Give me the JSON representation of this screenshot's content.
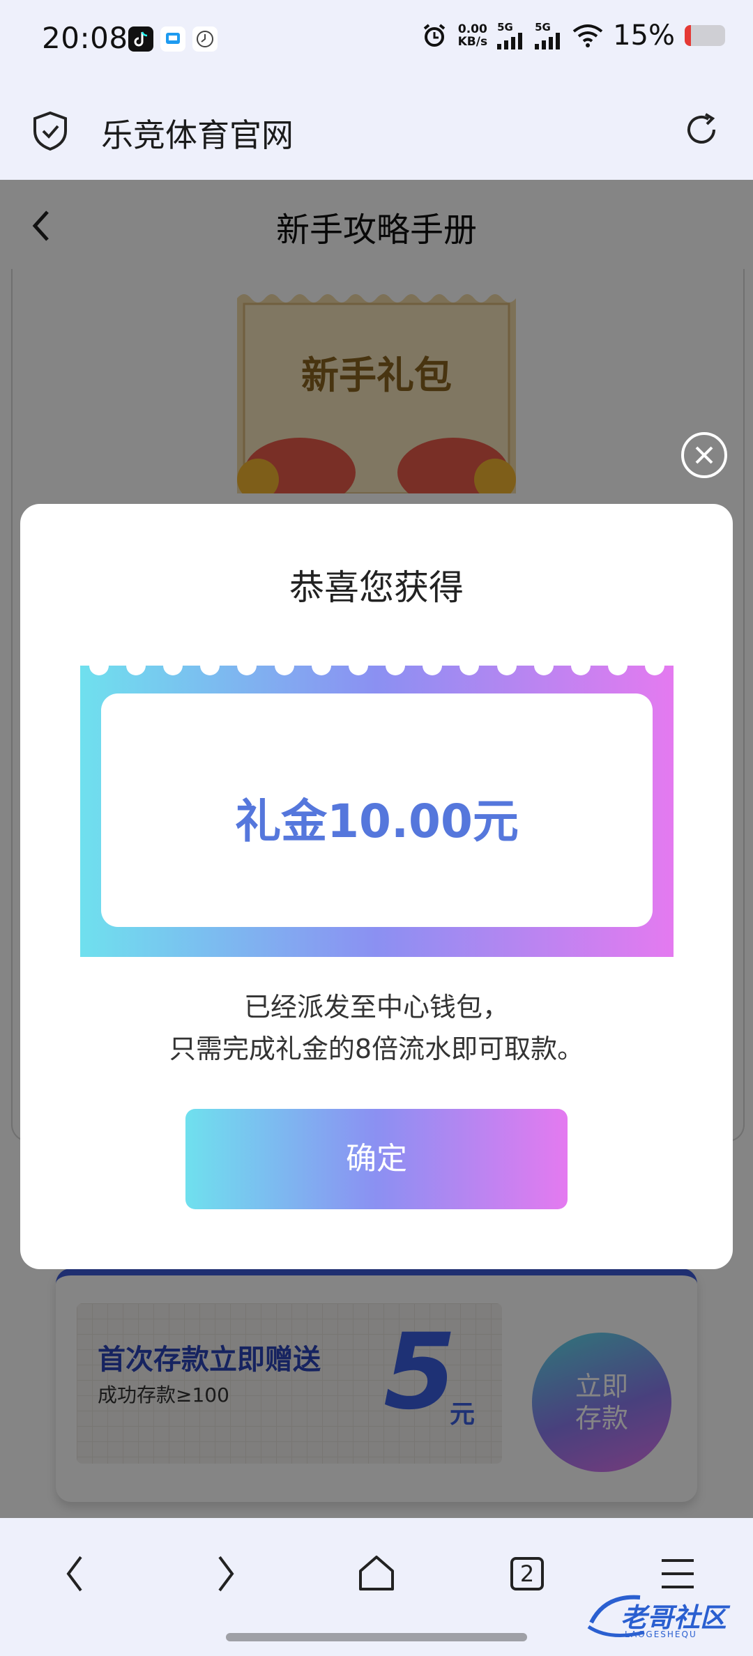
{
  "status_bar": {
    "time": "20:08",
    "net_speed_value": "0.00",
    "net_speed_unit": "KB/s",
    "sim1_label": "5G",
    "sim2_label": "5G",
    "battery_percent": "15%",
    "battery_level": 0.15,
    "icons": [
      "tiktok-icon",
      "app-icon",
      "clock-app-icon",
      "alarm-icon",
      "signal-icon",
      "signal-icon",
      "wifi-icon",
      "battery-icon"
    ]
  },
  "browser": {
    "site_title": "乐竞体育官网",
    "icons": [
      "shield-check-icon",
      "refresh-icon"
    ]
  },
  "page": {
    "header_title": "新手攻略手册",
    "gift_ticket_text": "新手礼包",
    "promo": {
      "title": "首次存款立即赠送",
      "subtitle": "成功存款≥100",
      "amount": "5",
      "unit": "元",
      "button_label_line1": "立即",
      "button_label_line2": "存款"
    }
  },
  "modal": {
    "title": "恭喜您获得",
    "reward_amount": "礼金10.00元",
    "description_line1": "已经派发至中心钱包，",
    "description_line2": "只需完成礼金的8倍流水即可取款。",
    "confirm_label": "确定"
  },
  "bottom_nav": {
    "tab_count": "2",
    "items": [
      "back-icon",
      "forward-icon",
      "home-icon",
      "tabs-icon",
      "menu-icon"
    ]
  },
  "watermark": {
    "text": "老哥社区",
    "sub": "LAOGESHEQU"
  },
  "colors": {
    "accent_blue": "#5577dc",
    "gradient_start": "#6fe0ee",
    "gradient_mid": "#8b90f2",
    "gradient_end": "#e47af0",
    "battery_low": "#e53935"
  }
}
